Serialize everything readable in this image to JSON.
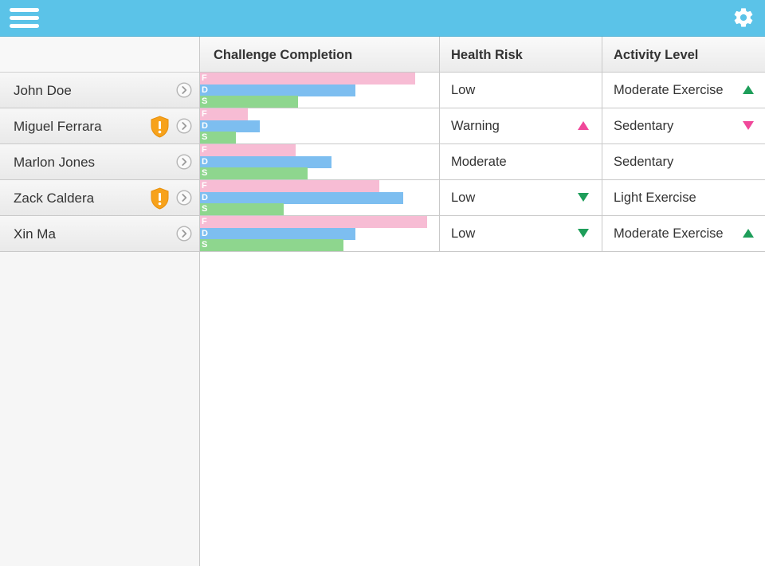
{
  "colors": {
    "header_bg": "#5bc3e8",
    "bar_f": "#f7bcd4",
    "bar_d": "#7dbef0",
    "bar_s": "#8ed68e",
    "arrow_up_green": "#1e9e5a",
    "arrow_up_pink": "#f0489a",
    "arrow_down_pink": "#f0489a",
    "arrow_down_green": "#1e9e5a",
    "warning_shield": "#f7a21b"
  },
  "toolbar": {
    "menu_icon": "hamburger-menu-icon",
    "settings_icon": "gear-icon"
  },
  "columns": {
    "challenge": "Challenge Completion",
    "health": "Health Risk",
    "activity": "Activity Level"
  },
  "bar_letters": {
    "f": "F",
    "d": "D",
    "s": "S"
  },
  "rows": [
    {
      "name": "John Doe",
      "warning": false,
      "bars": {
        "f": 0.9,
        "d": 0.65,
        "s": 0.41
      },
      "health": "Low",
      "health_trend": "none",
      "activity": "Moderate Exercise",
      "activity_trend": "up"
    },
    {
      "name": "Miguel Ferrara",
      "warning": true,
      "bars": {
        "f": 0.2,
        "d": 0.25,
        "s": 0.15
      },
      "health": "Warning",
      "health_trend": "up",
      "activity": "Sedentary",
      "activity_trend": "down"
    },
    {
      "name": "Marlon Jones",
      "warning": false,
      "bars": {
        "f": 0.4,
        "d": 0.55,
        "s": 0.45
      },
      "health": "Moderate",
      "health_trend": "none",
      "activity": "Sedentary",
      "activity_trend": "none"
    },
    {
      "name": "Zack Caldera",
      "warning": true,
      "bars": {
        "f": 0.75,
        "d": 0.85,
        "s": 0.35
      },
      "health": "Low",
      "health_trend": "down",
      "activity": "Light Exercise",
      "activity_trend": "none"
    },
    {
      "name": "Xin Ma",
      "warning": false,
      "bars": {
        "f": 0.95,
        "d": 0.65,
        "s": 0.6
      },
      "health": "Low",
      "health_trend": "down",
      "activity": "Moderate Exercise",
      "activity_trend": "up"
    }
  ]
}
